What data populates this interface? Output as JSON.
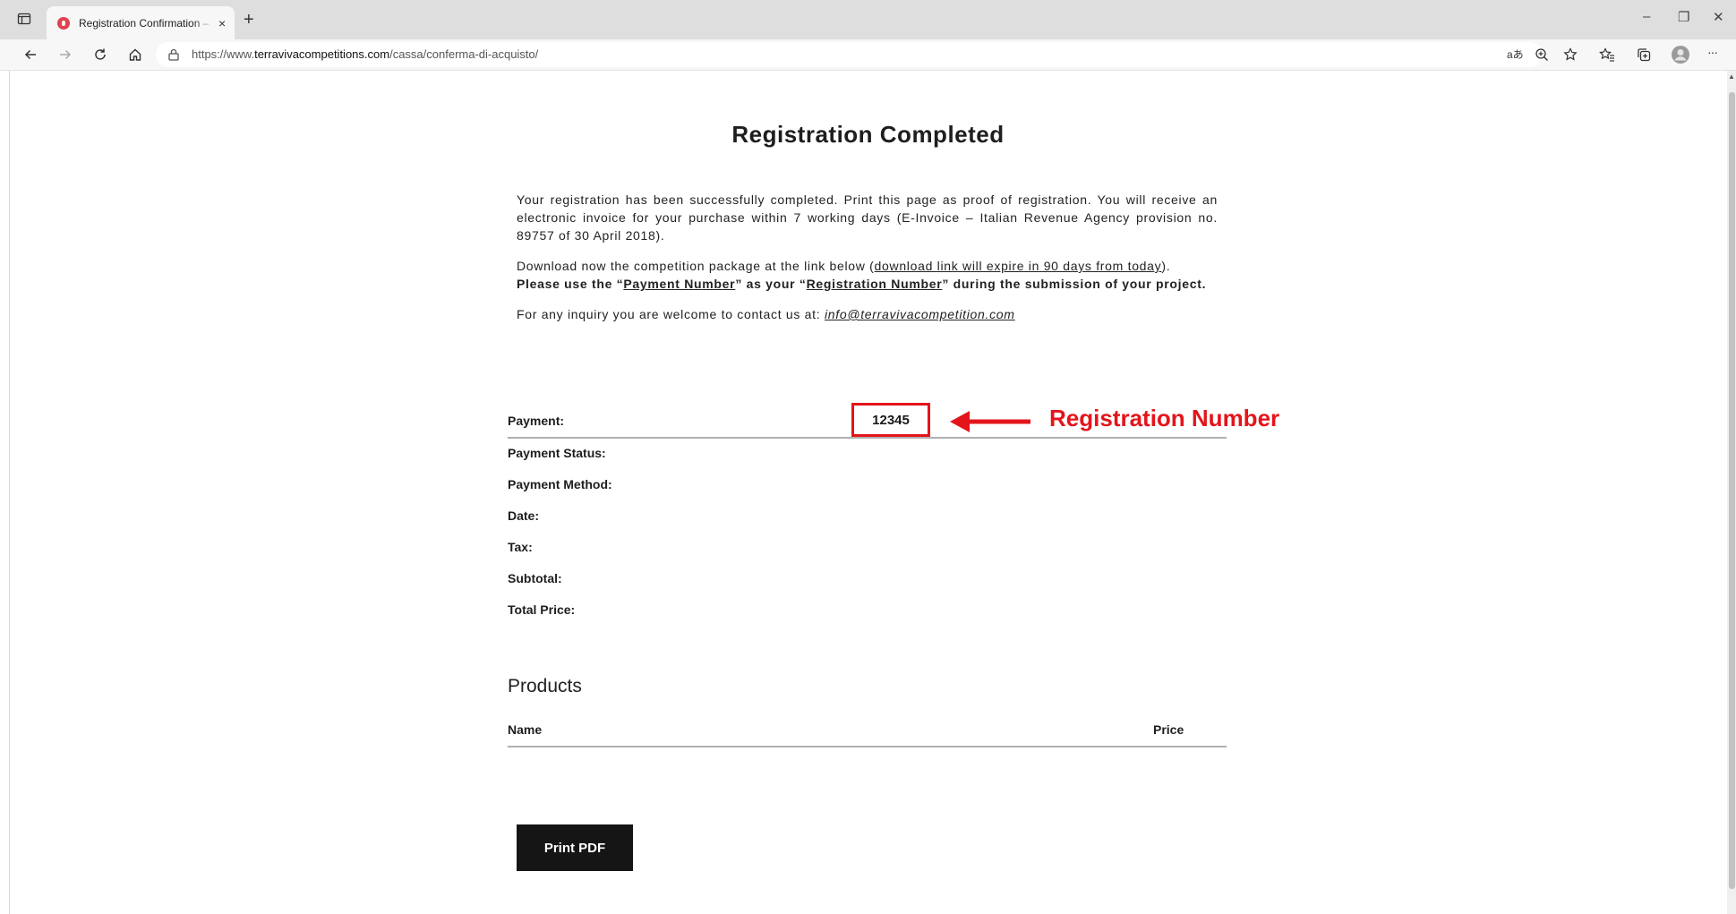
{
  "browser": {
    "tab_title": "Registration Confirmation – Terraviva Competitions",
    "tab_close": "×",
    "new_tab": "+",
    "url_prefix": "https://www.",
    "url_domain": "terravivacompetitions.com",
    "url_path": "/cassa/conferma-di-acquisto/",
    "read_aloud": "aあ",
    "minimize": "–",
    "restore": "❐",
    "close": "✕",
    "more": "···"
  },
  "page": {
    "title": "Registration Completed",
    "intro": "Your registration has been successfully completed. Print this page as proof of registration. You will receive an electronic invoice for your purchase within 7 working days (E-Invoice – Italian Revenue Agency provision no. 89757 of 30 April 2018).",
    "download_prefix": "Download now the competition package at the link below (",
    "download_link": "download link will expire in 90 days from today",
    "download_suffix": ").",
    "note_1": "Please use the “",
    "note_payment": "Payment Number",
    "note_2": "” as your “",
    "note_registration": "Registration Number",
    "note_3": "” during the submission of your project.",
    "contact_prefix": "For any inquiry you are welcome to contact us at: ",
    "contact_email": "info@terravivacompetition.com"
  },
  "details": {
    "payment_label": "Payment:",
    "payment_value": "12345",
    "status_label": "Payment Status:",
    "method_label": "Payment Method:",
    "date_label": "Date:",
    "tax_label": "Tax:",
    "subtotal_label": "Subtotal:",
    "total_label": "Total Price:"
  },
  "annotation": {
    "label": "Registration Number",
    "color": "#e3151b"
  },
  "products": {
    "heading": "Products",
    "col_name": "Name",
    "col_price": "Price"
  },
  "actions": {
    "print_label": "Print PDF"
  }
}
